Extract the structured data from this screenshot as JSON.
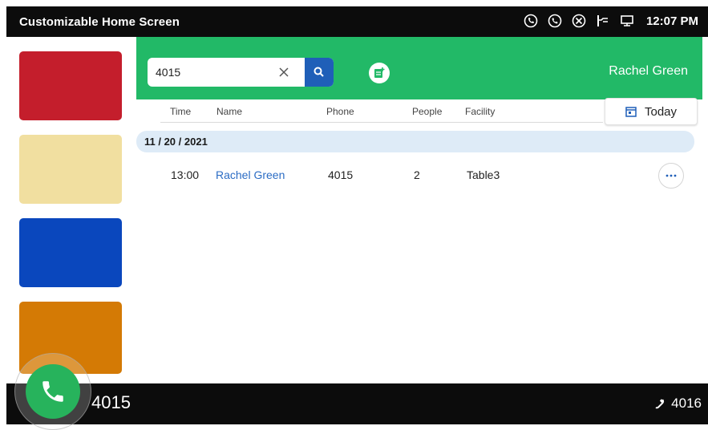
{
  "status_bar": {
    "title": "Customizable Home Screen",
    "time": "12:07 PM",
    "icons": [
      "call-forward-icon",
      "call-icon",
      "do-not-disturb-icon",
      "power-plug-icon",
      "monitor-icon"
    ]
  },
  "tiles": [
    {
      "color": "#c41e2c"
    },
    {
      "color": "#f1dfa0"
    },
    {
      "color": "#0a47bd"
    },
    {
      "color": "#d47a05"
    }
  ],
  "search": {
    "value": "4015",
    "placeholder": ""
  },
  "header": {
    "user_name": "Rachel Green",
    "accent_color": "#22b967"
  },
  "table": {
    "columns": [
      "Time",
      "Name",
      "Phone",
      "People",
      "Facility"
    ],
    "today_label": "Today",
    "date_group": "11 / 20 / 2021",
    "rows": [
      {
        "time": "13:00",
        "name": "Rachel Green",
        "phone": "4015",
        "people": "2",
        "facility": "Table3"
      }
    ]
  },
  "bottom_bar": {
    "line_number": "4015",
    "other_line": "4016"
  }
}
